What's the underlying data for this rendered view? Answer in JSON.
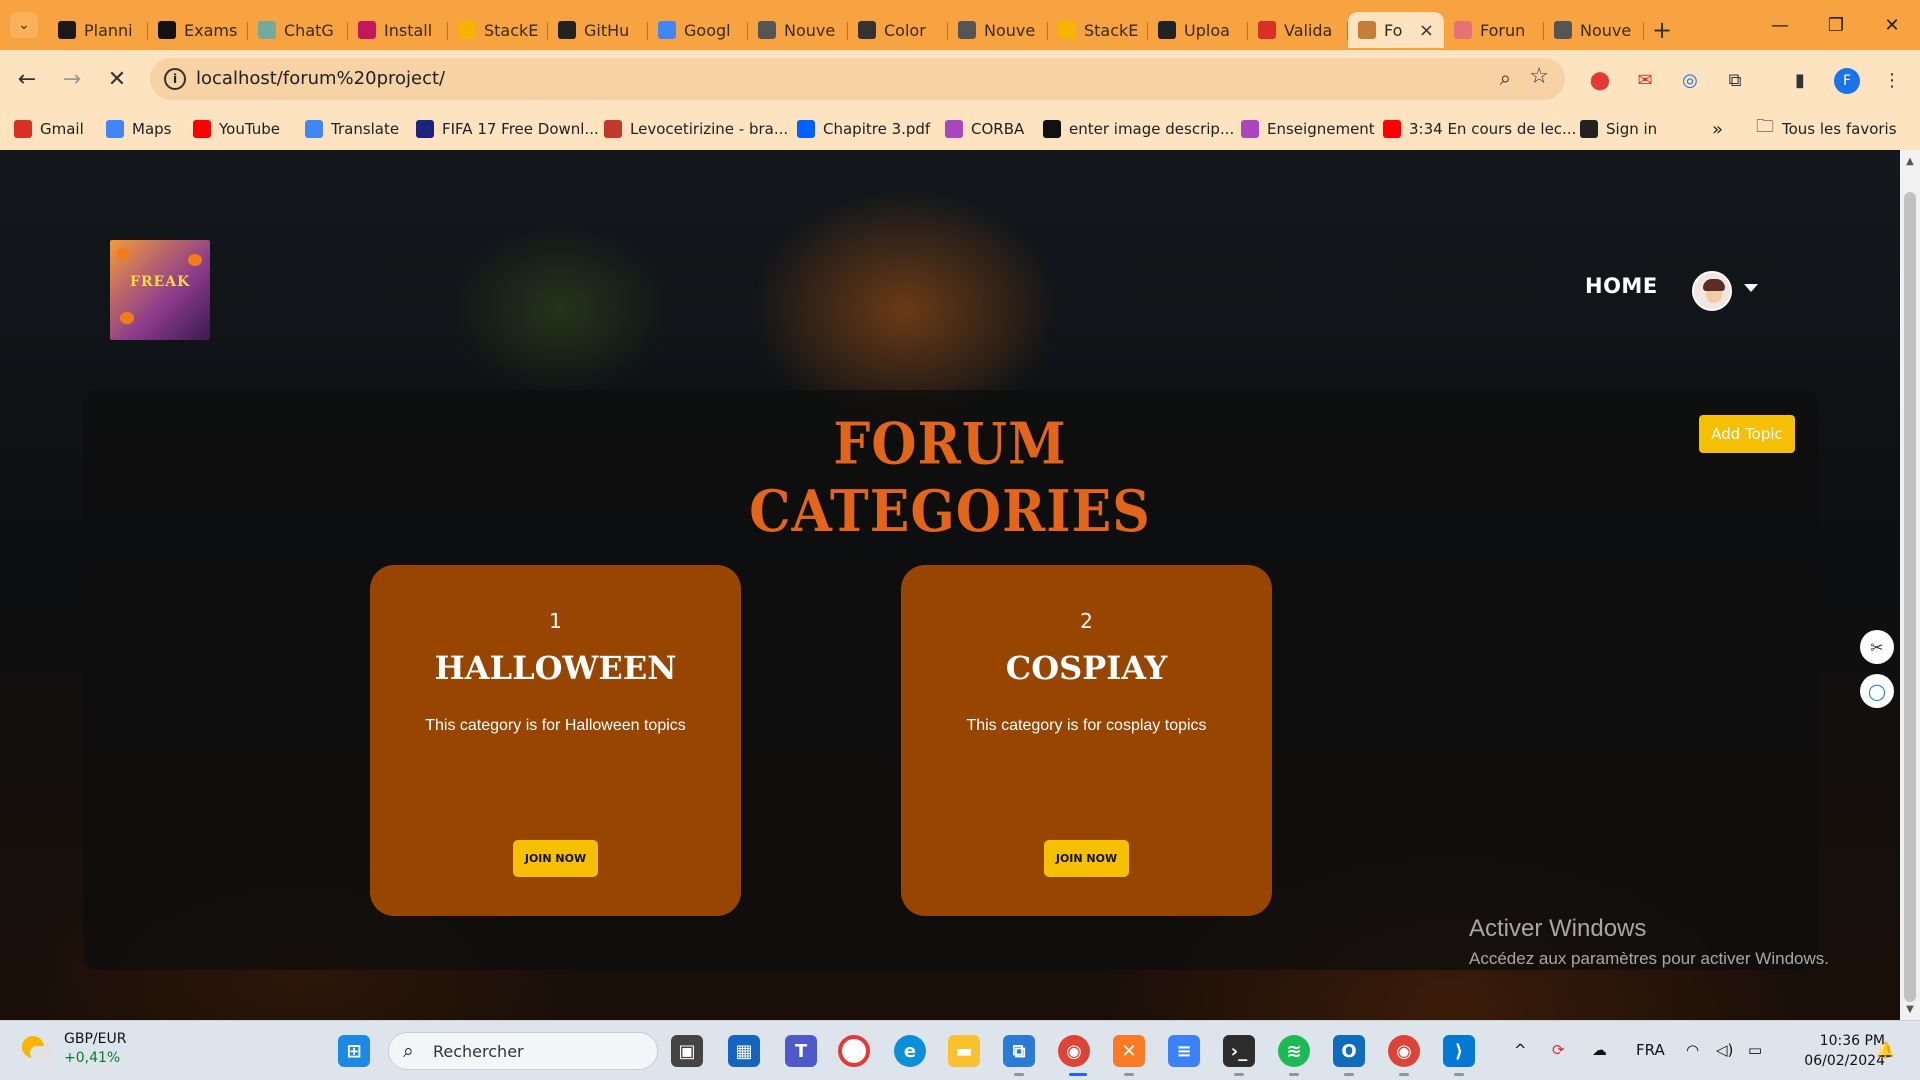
{
  "browser": {
    "tabs": [
      {
        "label": "Planni",
        "icon": "iT-favicon",
        "color": "#1a1a1a"
      },
      {
        "label": "Exams",
        "icon": "circle-favicon",
        "color": "#111111"
      },
      {
        "label": "ChatG",
        "icon": "chatgpt-favicon",
        "color": "#74aa9c"
      },
      {
        "label": "Install",
        "icon": "install-favicon",
        "color": "#c2185b"
      },
      {
        "label": "StackE",
        "icon": "stackedit-favicon",
        "color": "#f4b400"
      },
      {
        "label": "GitHu",
        "icon": "github-favicon",
        "color": "#222222"
      },
      {
        "label": "Googl",
        "icon": "google-translate-favicon",
        "color": "#4285f4"
      },
      {
        "label": "Nouve",
        "icon": "chrome-favicon",
        "color": "#555555"
      },
      {
        "label": "Color",
        "icon": "cup-favicon",
        "color": "#333333"
      },
      {
        "label": "Nouve",
        "icon": "chrome-favicon",
        "color": "#555555"
      },
      {
        "label": "StackE",
        "icon": "stackedit-favicon",
        "color": "#f4b400"
      },
      {
        "label": "Uploa",
        "icon": "github-favicon",
        "color": "#222222"
      },
      {
        "label": "Valida",
        "icon": "gmail-favicon",
        "color": "#d93025"
      }
    ],
    "active_tab": {
      "label": "Fo",
      "close": "×"
    },
    "tabs_after": [
      {
        "label": "Forun",
        "icon": "forum-favicon",
        "color": "#e57373"
      },
      {
        "label": "Nouve",
        "icon": "chrome-favicon",
        "color": "#555555"
      }
    ],
    "new_tab": "+",
    "url": "localhost/forum%20project/",
    "bookmarks": [
      {
        "label": "Gmail",
        "icon": "gmail-icon",
        "color": "#d93025"
      },
      {
        "label": "Maps",
        "icon": "google-icon",
        "color": "#4285f4"
      },
      {
        "label": "YouTube",
        "icon": "youtube-icon",
        "color": "#ff0000"
      },
      {
        "label": "Translate",
        "icon": "translate-icon",
        "color": "#4285f4"
      },
      {
        "label": "FIFA 17 Free Downl...",
        "icon": "s-icon",
        "color": "#1a237e"
      },
      {
        "label": "Levocetirizine - bra...",
        "icon": "molecule-icon",
        "color": "#c0392b"
      },
      {
        "label": "Chapitre 3.pdf",
        "icon": "dropbox-icon",
        "color": "#0061fe"
      },
      {
        "label": "CORBA",
        "icon": "bookmark-icon",
        "color": "#ab47bc"
      },
      {
        "label": "enter image descrip...",
        "icon": "info-icon",
        "color": "#111111"
      },
      {
        "label": "Enseignement",
        "icon": "bookmark-icon",
        "color": "#ab47bc"
      },
      {
        "label": "3:34 En cours de lec...",
        "icon": "youtube-icon",
        "color": "#ff0000"
      },
      {
        "label": "Sign in",
        "icon": "github-icon",
        "color": "#222222"
      }
    ],
    "bookmarks_more": "»",
    "all_bookmarks": "Tous les favoris"
  },
  "site": {
    "logo_text": "FREAK",
    "nav_home": "HOME",
    "add_topic": "Add Topic",
    "section_title": "Forum Categories",
    "categories": [
      {
        "id": "1",
        "name": "Halloween",
        "description": "This category is for Halloween topics",
        "button": "Join Now"
      },
      {
        "id": "2",
        "name": "Cospiay",
        "description": "This category is for cosplay topics",
        "button": "Join Now"
      }
    ]
  },
  "watermark": {
    "title": "Activer Windows",
    "subtitle": "Accédez aux paramètres pour activer Windows."
  },
  "taskbar": {
    "weather_pair": "GBP/EUR",
    "weather_change": "+0,41%",
    "search_placeholder": "Rechercher",
    "language": "FRA",
    "time": "10:36 PM",
    "date": "06/02/2024"
  },
  "colors": {
    "tabstrip": "#f7a341",
    "toolbar": "#fde3bf",
    "card": "#974500",
    "accent_yellow": "#f5c003",
    "title_orange": "#e2651a"
  }
}
